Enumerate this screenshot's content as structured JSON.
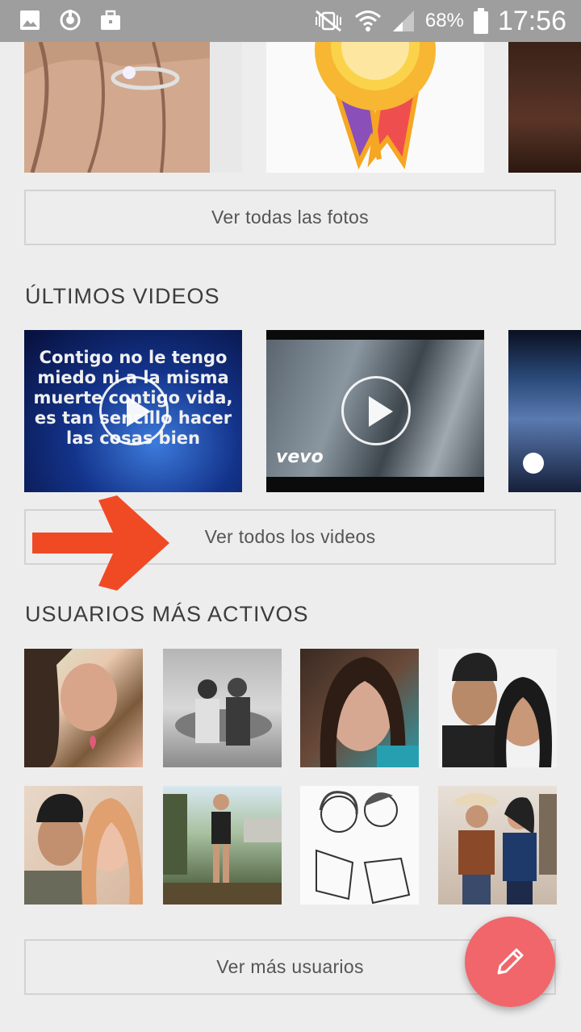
{
  "status_bar": {
    "battery_percent": "68%",
    "time": "17:56",
    "icons": [
      "gallery-icon",
      "sync-icon",
      "briefcase-icon",
      "mute-vibrate-icon",
      "wifi-icon",
      "signal-icon",
      "battery-icon"
    ]
  },
  "photos": {
    "view_all_label": "Ver todas las fotos"
  },
  "videos": {
    "heading": "ÚLTIMOS VIDEOS",
    "video1_caption": "Contigo no le tengo miedo ni a la misma muerte contigo vida, es tan sencillo hacer las cosas bien",
    "video2_watermark": "vevo",
    "view_all_label": "Ver todos los videos"
  },
  "users": {
    "heading": "USUARIOS MÁS ACTIVOS",
    "view_more_label": "Ver más usuarios"
  },
  "colors": {
    "accent_fab": "#f0666a",
    "arrow": "#f04a25",
    "status_bar": "#9e9e9e"
  }
}
